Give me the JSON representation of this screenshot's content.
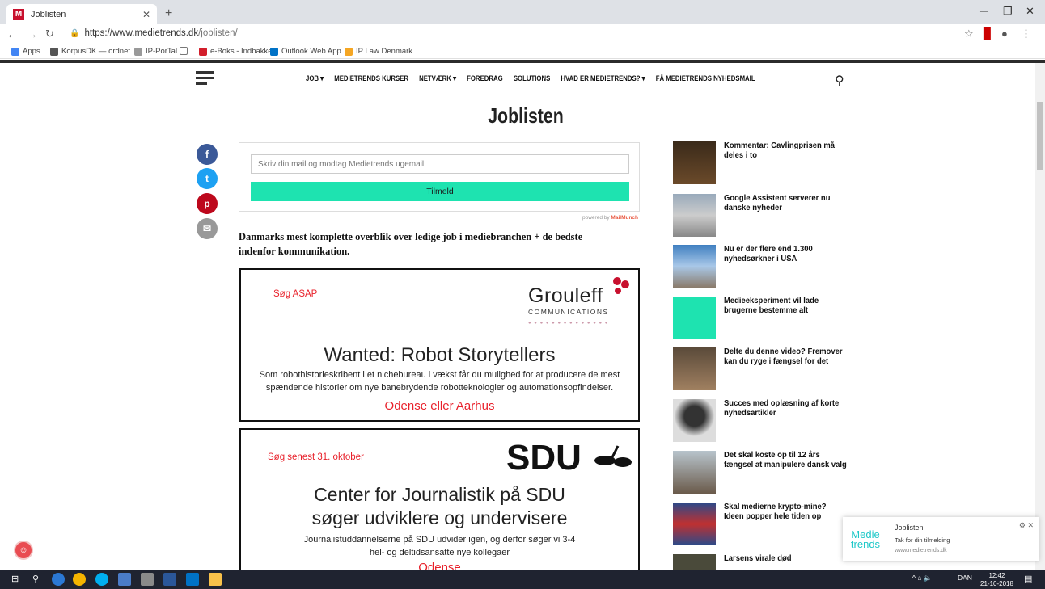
{
  "browser": {
    "tab_title": "Joblisten",
    "tab_favicon": "M",
    "url_host": "https://www.medietrends.dk",
    "url_path": "/joblisten/",
    "bookmarks": [
      "Apps",
      "KorpusDK — ordnet",
      "IP-PorTal",
      "e-Boks - Indbakke",
      "Outlook Web App",
      "IP Law Denmark"
    ]
  },
  "nav": {
    "items": [
      "JOB ▾",
      "MEDIETRENDS KURSER",
      "NETVÆRK ▾",
      "FOREDRAG",
      "SOLUTIONS",
      "HVAD ER MEDIETRENDS? ▾",
      "FÅ MEDIETRENDS NYHEDSMAIL"
    ]
  },
  "page": {
    "title": "Joblisten",
    "signup_placeholder": "Skriv din mail og modtag Medietrends ugemail",
    "signup_button": "Tilmeld",
    "powered_by": "powered by",
    "powered_brand": "MailMunch",
    "intro": "Danmarks mest komplette overblik over ledige job i mediebranchen + de bedste indenfor kommunikation."
  },
  "social": [
    "f",
    "t",
    "p",
    "✉"
  ],
  "ads": [
    {
      "tag": "Søg ASAP",
      "logo_name": "Grouleff",
      "logo_sub": "COMMUNICATIONS",
      "heading": "Wanted: Robot Storytellers",
      "body": "Som robothistorieskribent i et nichebureau i vækst får du mulighed for at producere de mest spændende historier om nye banebrydende robotteknologier og automationsopfindelser.",
      "location": "Odense eller Aarhus"
    },
    {
      "tag": "Søg senest 31. oktober",
      "logo_name": "SDU",
      "heading": "Center for Journalistik på SDU søger udviklere og undervisere",
      "body": "Journalistuddannelserne på SDU udvider igen, og derfor søger vi 3-4 hel- og deltidsansatte nye kollegaer",
      "location": "Odense"
    }
  ],
  "sidebar": [
    "Kommentar: Cavlingprisen må deles i to",
    "Google Assistent serverer nu danske nyheder",
    "Nu er der flere end 1.300 nyhedsørkner i USA",
    "Medieeksperiment vil lade brugerne bestemme alt",
    "Delte du denne video? Fremover kan du ryge i fængsel for det",
    "Succes med oplæsning af korte nyhedsartikler",
    "Det skal koste op til 12 års fængsel at manipulere dansk valg",
    "Skal medierne krypto-mine? Ideen popper hele tiden op",
    "Larsens virale død"
  ],
  "notification": {
    "logo": "Medie trends",
    "title": "Joblisten",
    "message": "Tak for din tilmelding",
    "site": "www.medietrends.dk"
  },
  "taskbar": {
    "lang": "DAN",
    "time": "12:42",
    "date": "21-10-2018"
  },
  "colors": {
    "accent_button": "#1ee3b0",
    "ad_red": "#e8202a",
    "facebook": "#3b5998",
    "twitter": "#1da1f2",
    "pinterest": "#bd081c",
    "email": "#999999"
  }
}
